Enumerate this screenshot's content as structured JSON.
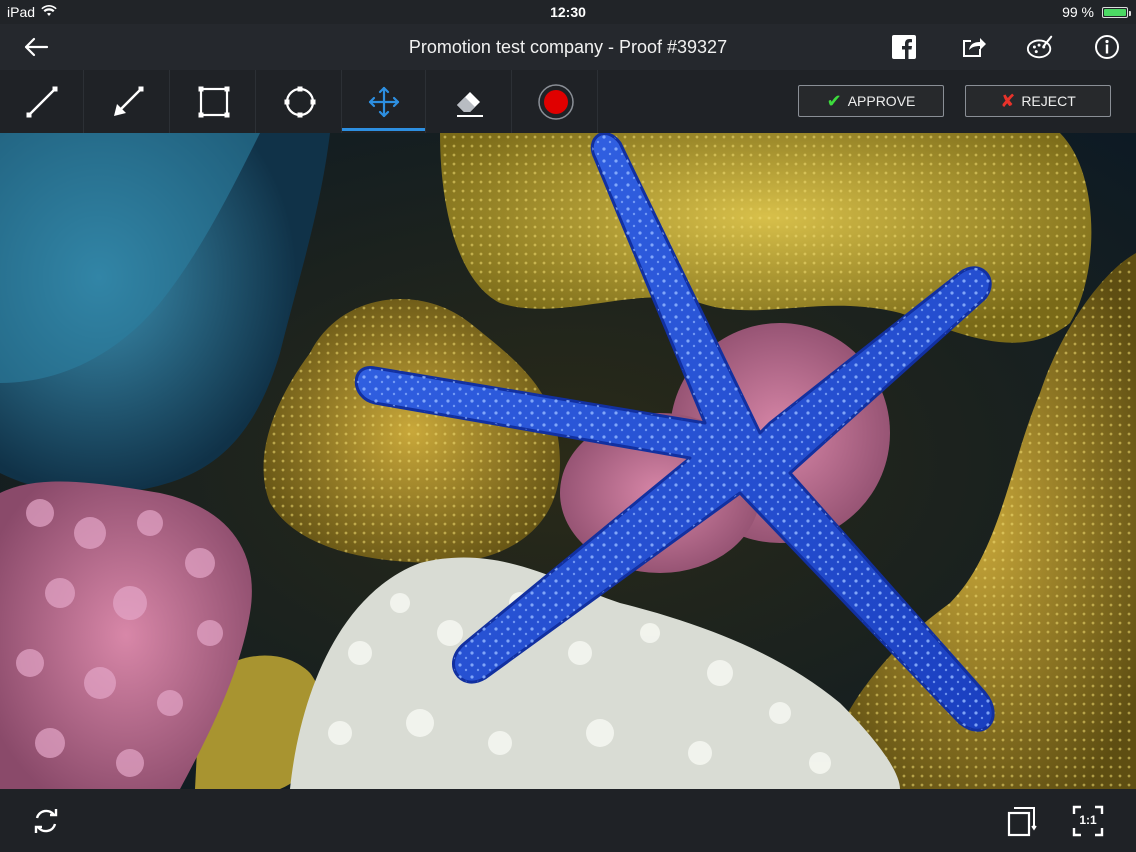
{
  "status": {
    "device": "iPad",
    "time": "12:30",
    "battery": "99 %",
    "battery_level": 0.99
  },
  "header": {
    "title": "Promotion test company - Proof #39327"
  },
  "toolbar": {
    "tools": [
      {
        "name": "line",
        "icon": "line-tool-icon"
      },
      {
        "name": "arrow",
        "icon": "arrow-tool-icon"
      },
      {
        "name": "rectangle",
        "icon": "rectangle-tool-icon"
      },
      {
        "name": "ellipse",
        "icon": "ellipse-tool-icon"
      },
      {
        "name": "move",
        "icon": "move-tool-icon",
        "active": true
      },
      {
        "name": "eraser",
        "icon": "eraser-tool-icon"
      },
      {
        "name": "color",
        "icon": "color-picker-icon",
        "color": "#e00000"
      }
    ],
    "approve_label": "APPROVE",
    "reject_label": "REJECT",
    "approve_color": "#3ddc3d",
    "reject_color": "#e8322a",
    "accent": "#2d8fe0"
  },
  "header_actions": [
    "facebook-icon",
    "share-icon",
    "palette-icon",
    "info-icon"
  ],
  "bottom": {
    "fit_label": "1:1",
    "actions": [
      "refresh-icon",
      "fit-page-icon",
      "actual-size-icon"
    ]
  }
}
